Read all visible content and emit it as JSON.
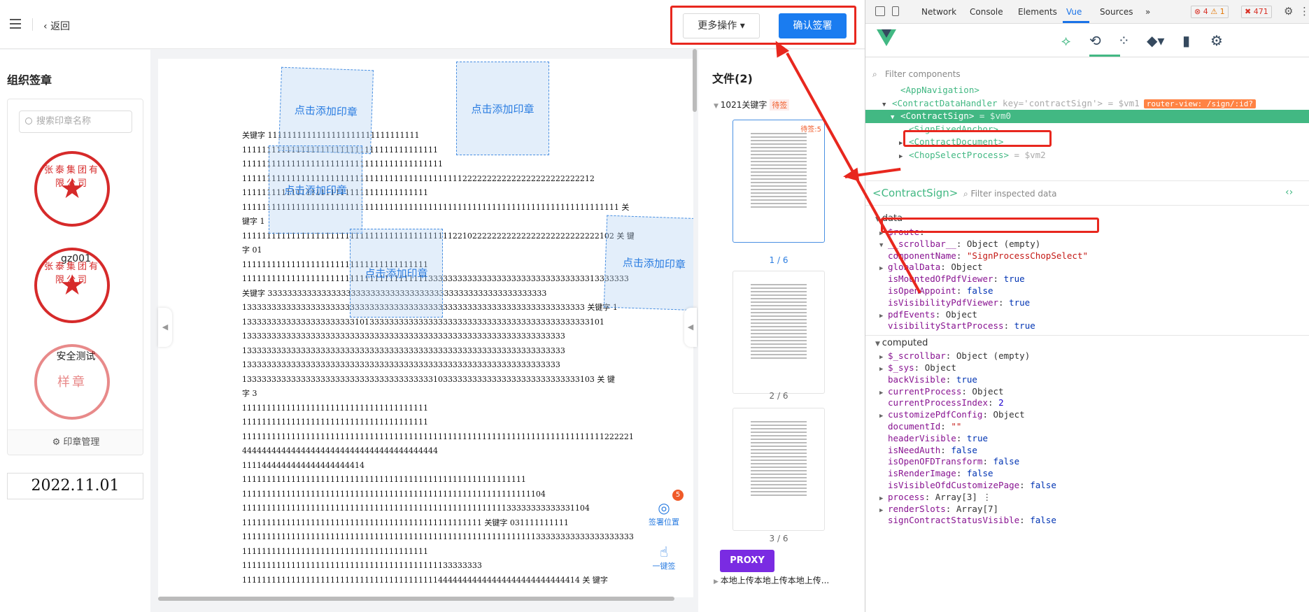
{
  "topbar": {
    "back_label": "返回",
    "more_label": "更多操作 ▾",
    "confirm_label": "确认签署"
  },
  "left_panel": {
    "title": "组织签章",
    "search_placeholder": "搜索印章名称",
    "seals": [
      {
        "name": "gz001",
        "ring_text": "张泰集团有限公司"
      },
      {
        "name": "安全测试",
        "ring_text": "张泰集团有限公司"
      },
      {
        "name": "",
        "ring_text": "样章"
      }
    ],
    "manage_label": "印章管理",
    "date_value": "2022.11.01"
  },
  "document": {
    "zone_label": "点击添加印章",
    "lines": [
      "关键字 1111111111111111111111111111111",
      "1111111111111111111111111111111111111111",
      "11111111111111111111111111111111111111111",
      "111111111111111111111111111111111111111111111222222222222222222222222212",
      "11111111111111111111111111111111111111",
      "11111111111111111111111111111111111111111111111111111111111111111111111111111 关",
      "键字 1",
      "1111111111111111111111111111111111111111111221022222222222222222222222222102 关 键",
      "字 01",
      "11111111111111111111111111111111111111",
      "1111111111111111111111111111111111111133333333333333333333333333333333313333333",
      "关键字 333333333333333333333333333333333333333333333333333333333",
      "1333333333333333333333333333333333333333333333333333333333333333333333 关键字 1",
      "13333333333333333333333101333333333333333333333333333333333333333333333101",
      "133333333333333333333333333333333333333333333333333333333333333333",
      "133333333333333333333333333333333333333333333333333333333333333333",
      "13333333333333333333333333333333333333333333333333333333333333333",
      "133333333333333333333333333333333333333103333333333333333333333333333103 关 键",
      "字 3",
      "11111111111111111111111111111111111111",
      "11111111111111111111111111111111111111",
      "11111111111111111111111111111111111111111111111111111111111111111111111111222221444",
      "4444444444444444444444444444444444444444",
      "1111444444444444444444414",
      "1111111111111111111111111111111111111111111111111111111111",
      "11111111111111111111111111111111111111111111111111111111111104",
      "11111111111111111111111111111111111111111111111111111133333333333331104",
      "1111111111111111111111111111111111111111111111111 关键字 031111111111",
      "11111111111111111111111111111111111111111111111111111111111133333333333333333333",
      "11111111111111111111111111111111111111",
      "1111111111111111111111111111111111111111133333333",
      "111111111111111111111111111111111111111144444444444444444444444444414 关 键字"
    ],
    "float_sign_pos_label": "签署位置",
    "float_sign_pos_badge": "5",
    "float_one_key_label": "一键签"
  },
  "right_panel": {
    "title": "文件(2)",
    "file1_name": "1021关键字",
    "file1_status": "待签",
    "file1_count_badge": "待签:5",
    "pages": [
      "1 / 6",
      "2 / 6",
      "3 / 6"
    ],
    "file2_name": "本地上传本地上传本地上传...",
    "proxy_label": "PROXY"
  },
  "devtools": {
    "tabs": [
      "Network",
      "Console",
      "Elements",
      "Vue",
      "Sources",
      "»"
    ],
    "active_tab": "Vue",
    "errors": "⊗ 4",
    "warnings": "⚠ 1",
    "issues": "✖ 471",
    "filter_placeholder": "Filter components",
    "tree": [
      {
        "indent": 3,
        "toggle": "",
        "name": "<AppNavigation>",
        "extra": ""
      },
      {
        "indent": 2,
        "toggle": "▼",
        "name": "<ContractDataHandler",
        "attr": " key='contractSign'",
        "tail": "> = $vm1",
        "router": "router-view: /sign/:id?"
      },
      {
        "indent": 3,
        "toggle": "▼",
        "name": "<ContractSign>",
        "extra": " = $vm0",
        "selected": true
      },
      {
        "indent": 4,
        "toggle": "",
        "name": "<SignFixedAnchor>",
        "extra": ""
      },
      {
        "indent": 4,
        "toggle": "▶",
        "name": "<ContractDocument>",
        "extra": ""
      },
      {
        "indent": 4,
        "toggle": "▶",
        "name": "<ChopSelectProcess>",
        "extra": " = $vm2"
      }
    ],
    "inspect_title": "<ContractSign>",
    "inspect_filter": "Filter inspected data",
    "data_section": "data",
    "data_props": [
      {
        "toggle": "▶",
        "key": "$route",
        "value": "",
        "kind": "obj"
      },
      {
        "toggle": "▼",
        "key": "__scrollbar__",
        "value": "Object (empty)",
        "kind": "obj"
      },
      {
        "toggle": "",
        "key": "componentName",
        "value": "\"SignProcessChopSelect\"",
        "kind": "str"
      },
      {
        "toggle": "▶",
        "key": "globalData",
        "value": "Object",
        "kind": "obj"
      },
      {
        "toggle": "",
        "key": "isMountedOfPdfViewer",
        "value": "true",
        "kind": "bool"
      },
      {
        "toggle": "",
        "key": "isOpenAppoint",
        "value": "false",
        "kind": "bool"
      },
      {
        "toggle": "",
        "key": "isVisibilityPdfViewer",
        "value": "true",
        "kind": "bool"
      },
      {
        "toggle": "▶",
        "key": "pdfEvents",
        "value": "Object",
        "kind": "obj"
      },
      {
        "toggle": "",
        "key": "visibilityStartProcess",
        "value": "true",
        "kind": "bool"
      }
    ],
    "computed_section": "computed",
    "computed_props": [
      {
        "toggle": "▶",
        "key": "$_scrollbar",
        "value": "Object (empty)",
        "kind": "obj"
      },
      {
        "toggle": "▶",
        "key": "$_sys",
        "value": "Object",
        "kind": "obj"
      },
      {
        "toggle": "",
        "key": "backVisible",
        "value": "true",
        "kind": "bool"
      },
      {
        "toggle": "▶",
        "key": "currentProcess",
        "value": "Object",
        "kind": "obj"
      },
      {
        "toggle": "",
        "key": "currentProcessIndex",
        "value": "2",
        "kind": "num"
      },
      {
        "toggle": "▶",
        "key": "customizePdfConfig",
        "value": "Object",
        "kind": "obj"
      },
      {
        "toggle": "",
        "key": "documentId",
        "value": "\"\"",
        "kind": "str"
      },
      {
        "toggle": "",
        "key": "headerVisible",
        "value": "true",
        "kind": "bool"
      },
      {
        "toggle": "",
        "key": "isNeedAuth",
        "value": "false",
        "kind": "bool"
      },
      {
        "toggle": "",
        "key": "isOpenOFDTransform",
        "value": "false",
        "kind": "bool"
      },
      {
        "toggle": "",
        "key": "isRenderImage",
        "value": "false",
        "kind": "bool"
      },
      {
        "toggle": "",
        "key": "isVisibleOfdCustomizePage",
        "value": "false",
        "kind": "bool"
      },
      {
        "toggle": "▶",
        "key": "process",
        "value": "Array[3]  ⋮",
        "kind": "obj"
      },
      {
        "toggle": "▶",
        "key": "renderSlots",
        "value": "Array[7]",
        "kind": "obj"
      },
      {
        "toggle": "",
        "key": "signContractStatusVisible",
        "value": "false",
        "kind": "bool"
      }
    ]
  },
  "colors": {
    "primary": "#1a7cf0",
    "annotation_red": "#e8271e",
    "vue_green": "#42b883",
    "seal_red": "#d62a2a"
  }
}
